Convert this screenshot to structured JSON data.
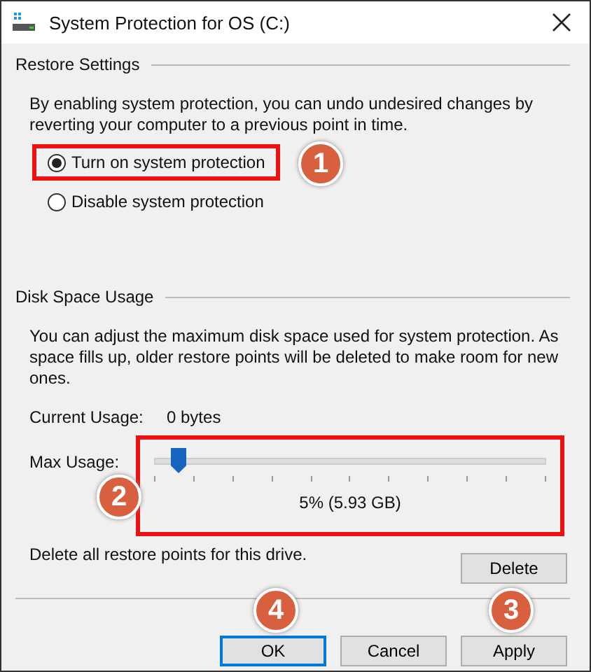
{
  "window": {
    "title": "System Protection for OS (C:)"
  },
  "restore_settings": {
    "heading": "Restore Settings",
    "description": "By enabling system protection, you can undo undesired changes by reverting your computer to a previous point in time.",
    "options": [
      {
        "label": "Turn on system protection",
        "selected": true,
        "highlighted": true
      },
      {
        "label": "Disable system protection",
        "selected": false,
        "highlighted": false
      }
    ]
  },
  "disk_space_usage": {
    "heading": "Disk Space Usage",
    "description": "You can adjust the maximum disk space used for system protection. As space fills up, older restore points will be deleted to make room for new ones.",
    "current_usage": {
      "label": "Current Usage:",
      "value": "0 bytes"
    },
    "max_usage": {
      "label": "Max Usage:",
      "level": 0.05,
      "reading": "5% (5.93 GB)",
      "highlighted": true
    },
    "delete_text": "Delete all restore points for this drive.",
    "delete_button": "Delete"
  },
  "buttons": [
    {
      "label": "OK",
      "default": true
    },
    {
      "label": "Cancel",
      "default": false
    },
    {
      "label": "Apply",
      "default": false
    }
  ],
  "annotations": [
    {
      "label": "1"
    },
    {
      "label": "2"
    },
    {
      "label": "3"
    },
    {
      "label": "4"
    }
  ]
}
